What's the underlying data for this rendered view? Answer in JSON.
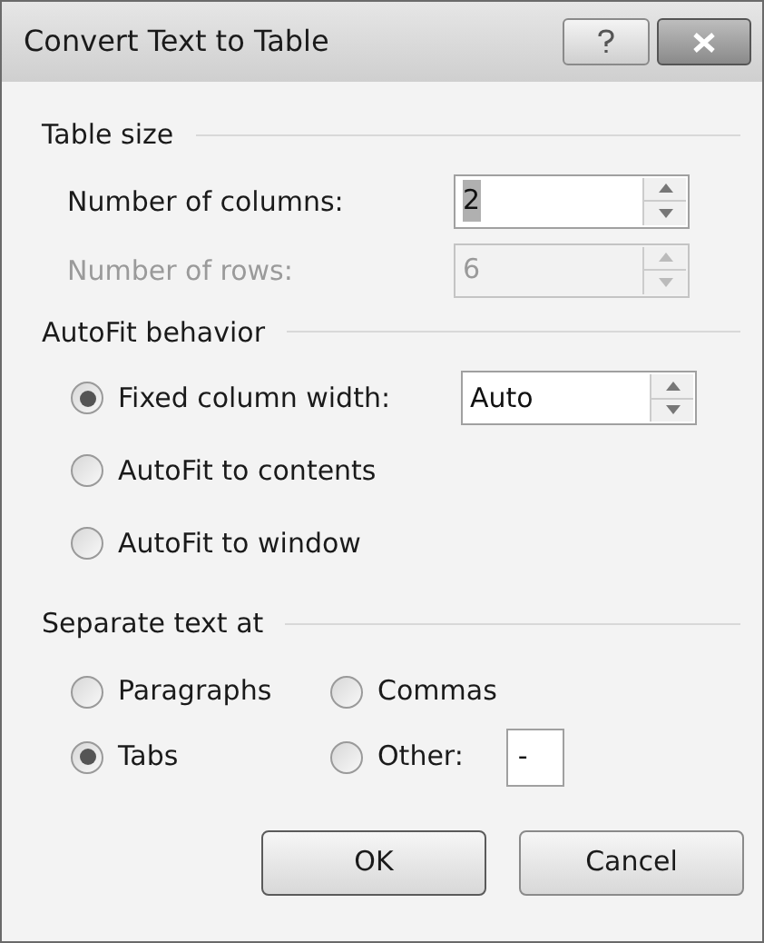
{
  "window": {
    "title": "Convert Text to Table"
  },
  "table_size": {
    "title": "Table size",
    "fields": [
      {
        "label": "Number of columns:",
        "value": "2",
        "disabled": false,
        "highlighted": true
      },
      {
        "label": "Number of rows:",
        "value": "6",
        "disabled": true,
        "highlighted": false
      }
    ]
  },
  "autofit": {
    "title": "AutoFit behavior",
    "options": [
      {
        "label": "Fixed column width:",
        "selected": true,
        "field_value": "Auto"
      },
      {
        "label": "AutoFit to contents",
        "selected": false
      },
      {
        "label": "AutoFit to window",
        "selected": false
      }
    ]
  },
  "separate": {
    "title": "Separate text at",
    "options": [
      {
        "label": "Paragraphs",
        "selected": false
      },
      {
        "label": "Commas",
        "selected": false
      },
      {
        "label": "Tabs",
        "selected": true
      },
      {
        "label": "Other:",
        "selected": false,
        "field_value": "-"
      }
    ]
  },
  "buttons": [
    {
      "label": "OK",
      "kind": "default"
    },
    {
      "label": "Cancel",
      "kind": "normal"
    }
  ]
}
